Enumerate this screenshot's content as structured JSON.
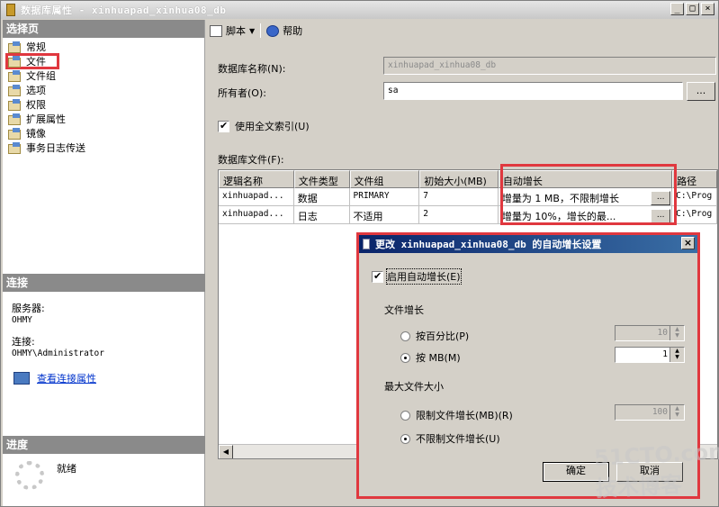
{
  "window": {
    "title": "数据库属性 - xinhuapad_xinhua08_db"
  },
  "title_buttons": [
    "_",
    "□",
    "×"
  ],
  "left": {
    "select_page_header": "选择页",
    "nav": [
      "常规",
      "文件",
      "文件组",
      "选项",
      "权限",
      "扩展属性",
      "镜像",
      "事务日志传送"
    ],
    "connection_header": "连接",
    "server_label": "服务器:",
    "server_value": "OHMY",
    "connection_label": "连接:",
    "connection_value": "OHMY\\Administrator",
    "view_link": "查看连接属性",
    "progress_header": "进度",
    "progress_status": "就绪"
  },
  "toolbar": {
    "script_label": "脚本",
    "help_label": "帮助"
  },
  "form": {
    "db_name_label": "数据库名称(N):",
    "db_name_value": "xinhuapad_xinhua08_db",
    "owner_label": "所有者(O):",
    "owner_value": "sa",
    "owner_btn": "...",
    "fulltext_label": "使用全文索引(U)",
    "files_label": "数据库文件(F):"
  },
  "grid": {
    "headers": [
      "逻辑名称",
      "文件类型",
      "文件组",
      "初始大小(MB)",
      "自动增长",
      "路径"
    ],
    "rows": [
      [
        "xinhuapad...",
        "数据",
        "PRIMARY",
        "7",
        "增量为 1 MB，不限制增长",
        "C:\\Prog"
      ],
      [
        "xinhuapad...",
        "日志",
        "不适用",
        "2",
        "增量为 10%，增长的最...",
        "C:\\Prog"
      ]
    ],
    "cell_button": "..."
  },
  "dialog": {
    "title": "更改 xinhuapad_xinhua08_db 的自动增长设置",
    "enable_label": "启用自动增长(E)",
    "growth_header": "文件增长",
    "percent_label": "按百分比(P)",
    "percent_value": "10",
    "mb_label": "按 MB(M)",
    "mb_value": "1",
    "max_header": "最大文件大小",
    "limit_label": "限制文件增长(MB)(R)",
    "limit_value": "100",
    "unlimited_label": "不限制文件增长(U)",
    "ok": "确定",
    "cancel": "取消"
  },
  "watermark": "51CTO.com 技术博客"
}
